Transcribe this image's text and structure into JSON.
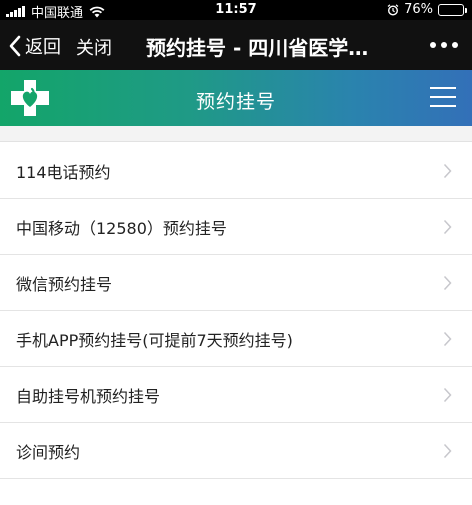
{
  "status_bar": {
    "carrier": "中国联通",
    "time": "11:57",
    "battery": "76%",
    "battery_level": 0.76
  },
  "nav": {
    "back_label": "返回",
    "close_label": "关闭",
    "title": "预约挂号 - 四川省医学…"
  },
  "banner": {
    "title": "预约挂号"
  },
  "list": {
    "items": [
      {
        "label": "114电话预约"
      },
      {
        "label": "中国移动（12580）预约挂号"
      },
      {
        "label": "微信预约挂号"
      },
      {
        "label": "手机APP预约挂号(可提前7天预约挂号)"
      },
      {
        "label": "自助挂号机预约挂号"
      },
      {
        "label": "诊间预约"
      }
    ]
  },
  "colors": {
    "banner_start": "#13a569",
    "banner_end": "#3370b8",
    "nav_bg": "#111111"
  }
}
